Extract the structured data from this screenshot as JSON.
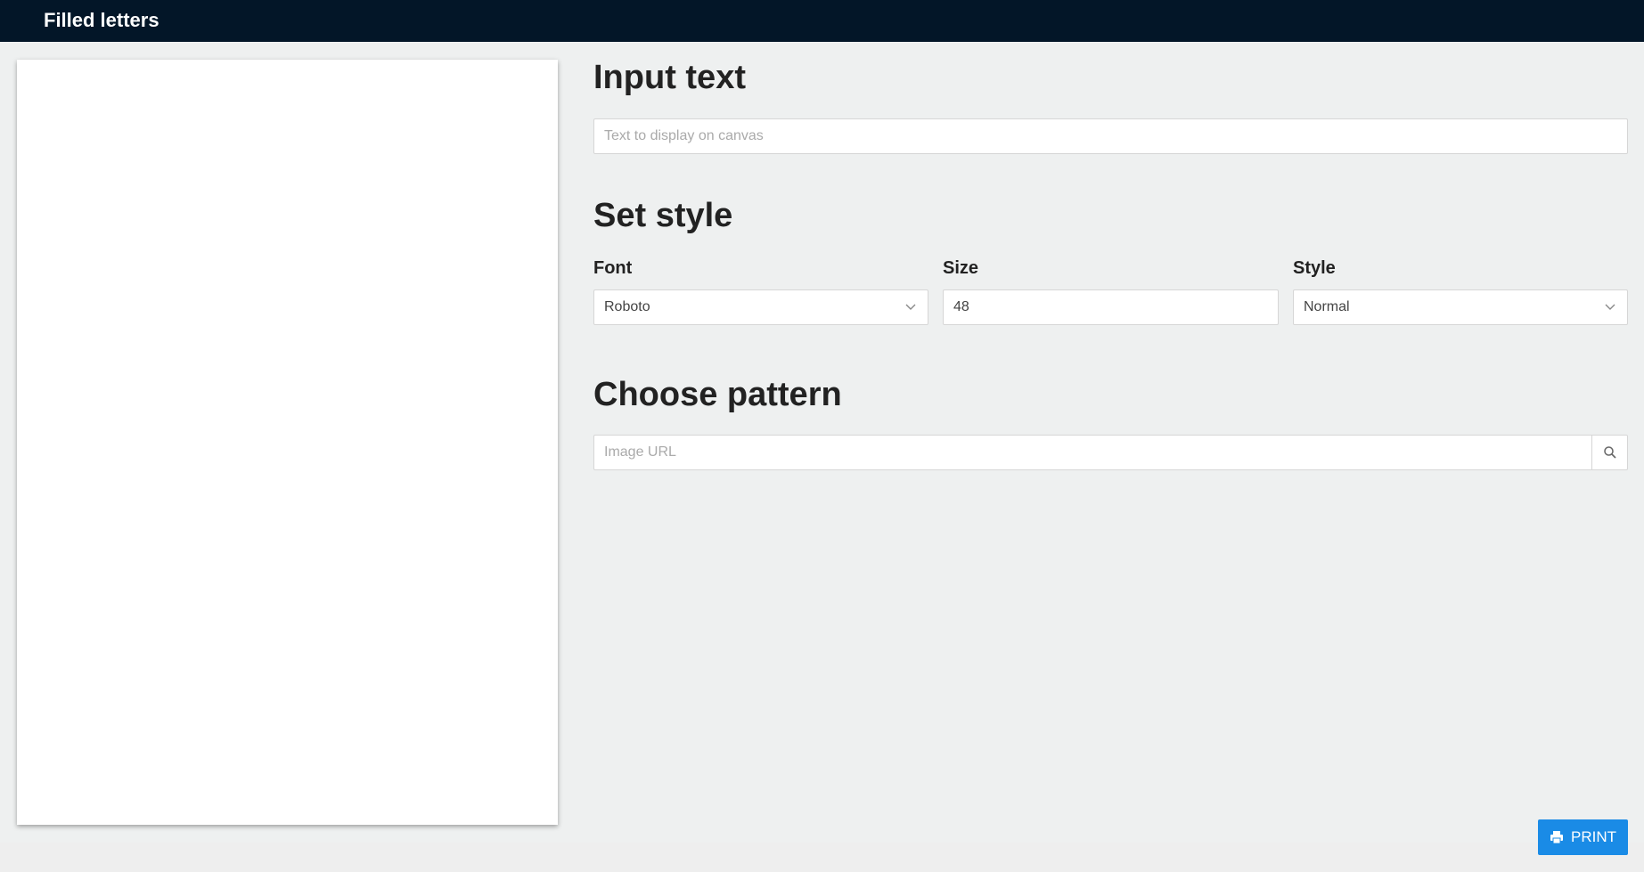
{
  "header": {
    "title": "Filled letters"
  },
  "input_text": {
    "title": "Input text",
    "placeholder": "Text to display on canvas",
    "value": ""
  },
  "set_style": {
    "title": "Set style",
    "font": {
      "label": "Font",
      "value": "Roboto"
    },
    "size": {
      "label": "Size",
      "value": "48"
    },
    "style": {
      "label": "Style",
      "value": "Normal"
    }
  },
  "choose_pattern": {
    "title": "Choose pattern",
    "placeholder": "Image URL",
    "value": ""
  },
  "print_button": {
    "label": "PRINT"
  },
  "icons": {
    "search": "search-icon",
    "print": "print-icon",
    "chevron": "chevron-down-icon"
  },
  "colors": {
    "topbar": "#031628",
    "accent": "#1a8be6",
    "background": "#eef0f0"
  }
}
